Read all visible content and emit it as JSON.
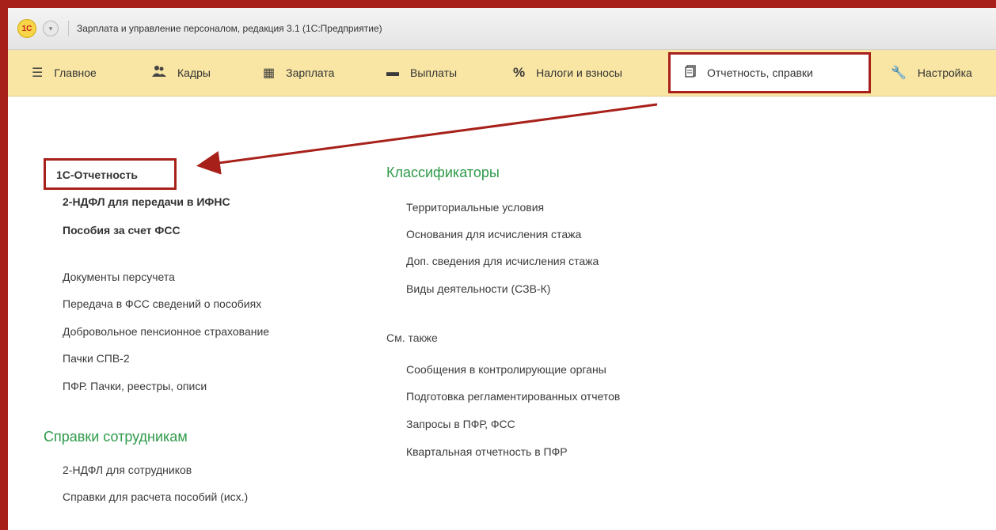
{
  "window": {
    "logo_text": "1С",
    "title": "Зарплата и управление персоналом, редакция 3.1  (1С:Предприятие)"
  },
  "menu": {
    "items": [
      {
        "label": "Главное",
        "icon": "hamburger-icon"
      },
      {
        "label": "Кадры",
        "icon": "people-icon"
      },
      {
        "label": "Зарплата",
        "icon": "calculator-icon"
      },
      {
        "label": "Выплаты",
        "icon": "wallet-icon"
      },
      {
        "label": "Налоги и взносы",
        "icon": "percent-icon"
      },
      {
        "label": "Отчетность, справки",
        "icon": "documents-icon",
        "active": true
      },
      {
        "label": "Настройка",
        "icon": "wrench-icon"
      }
    ]
  },
  "left": {
    "bold_links": [
      "1С-Отчетность",
      "2-НДФЛ для передачи в ИФНС",
      "Пособия за счет ФСС"
    ],
    "links": [
      "Документы персучета",
      "Передача в ФСС сведений о пособиях",
      "Добровольное пенсионное страхование",
      "Пачки СПВ-2",
      "ПФР. Пачки, реестры, описи"
    ],
    "section_title": "Справки сотрудникам",
    "section_links": [
      "2-НДФЛ для сотрудников",
      "Справки для расчета пособий (исх.)"
    ]
  },
  "right": {
    "section_title": "Классификаторы",
    "classifiers": [
      "Территориальные условия",
      "Основания для исчисления стажа",
      "Доп. сведения для исчисления стажа",
      "Виды деятельности (СЗВ-К)"
    ],
    "see_also_label": "См. также",
    "see_also": [
      "Сообщения в контролирующие органы",
      "Подготовка регламентированных отчетов",
      "Запросы в ПФР, ФСС",
      "Квартальная отчетность в ПФР"
    ]
  },
  "colors": {
    "accent_red": "#a8201a",
    "menu_bg": "#f9e6a4",
    "section_green": "#2f9a4a"
  }
}
